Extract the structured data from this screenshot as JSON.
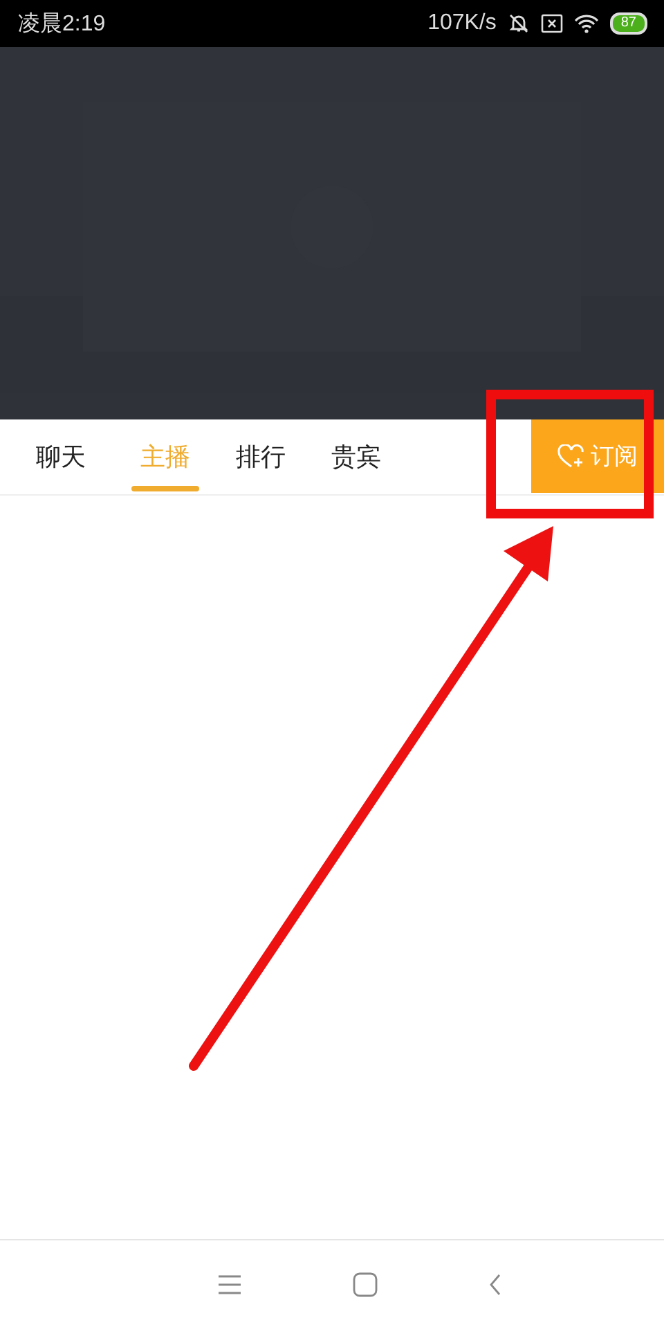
{
  "status_bar": {
    "time": "凌晨2:19",
    "network_speed": "107K/s",
    "battery": "87"
  },
  "tabs": [
    {
      "label": "聊天",
      "selected": false
    },
    {
      "label": "主播",
      "selected": true
    },
    {
      "label": "排行",
      "selected": false
    },
    {
      "label": "贵宾",
      "selected": false
    }
  ],
  "subscribe_button": {
    "label": "订阅"
  }
}
